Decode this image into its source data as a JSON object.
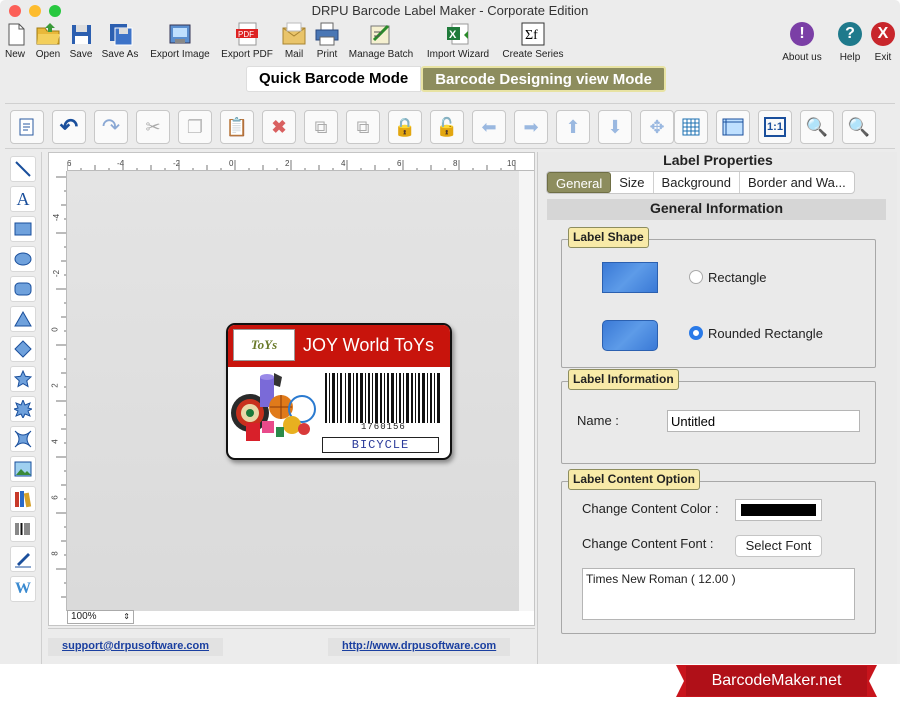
{
  "window": {
    "title": "DRPU Barcode Label Maker - Corporate Edition"
  },
  "toolbar_main": [
    {
      "label": "New",
      "icon": "new-document-icon"
    },
    {
      "label": "Open",
      "icon": "folder-open-icon"
    },
    {
      "label": "Save",
      "icon": "floppy-disk-icon"
    },
    {
      "label": "Save As",
      "icon": "save-as-icon"
    },
    {
      "label": "Export Image",
      "icon": "export-image-icon"
    },
    {
      "label": "Export PDF",
      "icon": "pdf-icon"
    },
    {
      "label": "Mail",
      "icon": "mail-icon"
    },
    {
      "label": "Print",
      "icon": "printer-icon"
    },
    {
      "label": "Manage Batch",
      "icon": "batch-icon"
    },
    {
      "label": "Import Wizard",
      "icon": "excel-icon"
    },
    {
      "label": "Create Series",
      "icon": "sigma-icon"
    }
  ],
  "toolbar_right": [
    {
      "label": "About us",
      "glyph": "!",
      "color": "#7b3fa6"
    },
    {
      "label": "Help",
      "glyph": "?",
      "color": "#1f7a8c"
    },
    {
      "label": "Exit",
      "glyph": "X",
      "color": "#c8262c"
    }
  ],
  "modes": {
    "quick": "Quick Barcode Mode",
    "design": "Barcode Designing view Mode"
  },
  "ruler": {
    "h": [
      "6",
      "-4",
      "-2",
      "0",
      "2",
      "4",
      "6",
      "8",
      "10"
    ],
    "v": [
      "-4",
      "-2",
      "0",
      "2",
      "4",
      "6",
      "8"
    ]
  },
  "zoom": "100%",
  "label_design": {
    "logo": "ToYs",
    "title": "JOY World ToYs",
    "barcode_number": "1760156",
    "caption": "BICYCLE"
  },
  "footer": {
    "email": "support@drpusoftware.com",
    "website": "http://www.drpusoftware.com"
  },
  "panel": {
    "title": "Label Properties",
    "tabs": [
      "General",
      "Size",
      "Background",
      "Border and Wa..."
    ],
    "section_title": "General Information",
    "shape_group": "Label Shape",
    "shape_rect": "Rectangle",
    "shape_rounded": "Rounded Rectangle",
    "info_group": "Label Information",
    "name_label": "Name :",
    "name_value": "Untitled",
    "content_group": "Label Content Option",
    "color_label": "Change Content Color :",
    "content_color": "#000000",
    "font_label": "Change Content Font :",
    "font_button": "Select Font",
    "font_value": "Times New Roman ( 12.00 )"
  },
  "badge": "BarcodeMaker.net"
}
